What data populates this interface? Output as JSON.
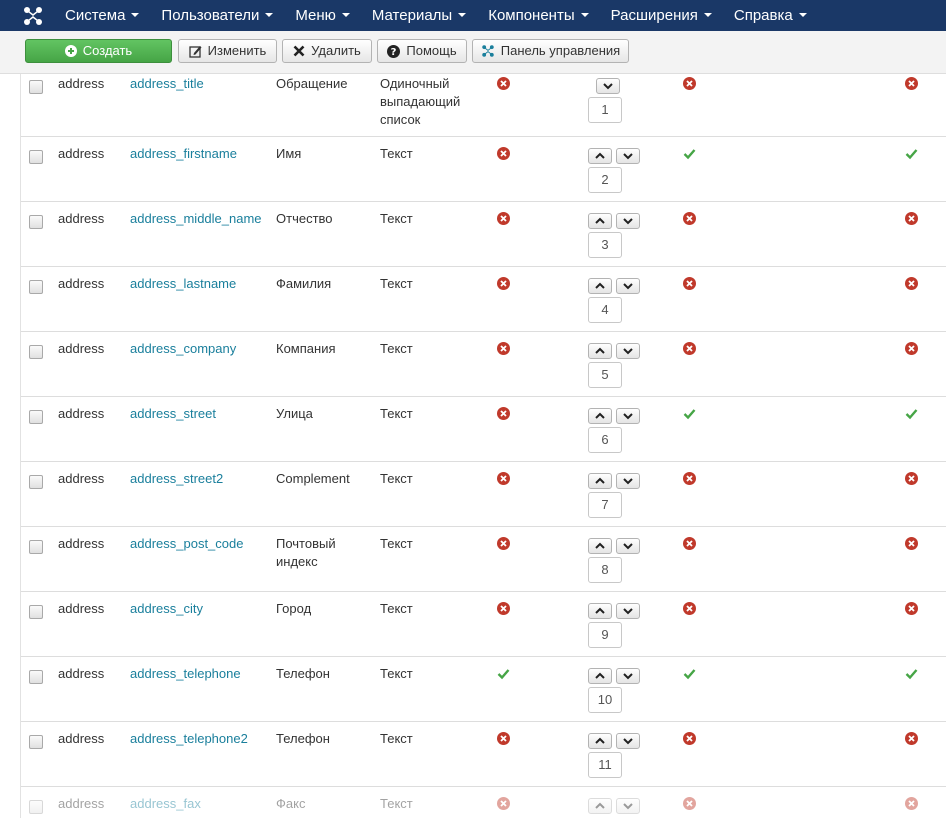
{
  "nav": {
    "menu": [
      "Система",
      "Пользователи",
      "Меню",
      "Материалы",
      "Компоненты",
      "Расширения",
      "Справка"
    ]
  },
  "toolbar": {
    "create_label": "Создать",
    "edit_label": "Изменить",
    "delete_label": "Удалить",
    "help_label": "Помощь",
    "control_panel_label": "Панель управления"
  },
  "colors": {
    "navbar": "#1a3867",
    "link": "#1a7f9c",
    "error": "#c0392b",
    "success": "#46a546"
  },
  "rows": [
    {
      "group": "address",
      "name": "address_title",
      "title": "Обращение",
      "type": "Одиночный выпадающий список",
      "s1": "no",
      "order": "1",
      "s2": "no",
      "s3": "no",
      "up": false
    },
    {
      "group": "address",
      "name": "address_firstname",
      "title": "Имя",
      "type": "Текст",
      "s1": "no",
      "order": "2",
      "s2": "yes",
      "s3": "yes",
      "up": true
    },
    {
      "group": "address",
      "name": "address_middle_name",
      "title": "Отчество",
      "type": "Текст",
      "s1": "no",
      "order": "3",
      "s2": "no",
      "s3": "no",
      "up": true
    },
    {
      "group": "address",
      "name": "address_lastname",
      "title": "Фамилия",
      "type": "Текст",
      "s1": "no",
      "order": "4",
      "s2": "no",
      "s3": "no",
      "up": true
    },
    {
      "group": "address",
      "name": "address_company",
      "title": "Компания",
      "type": "Текст",
      "s1": "no",
      "order": "5",
      "s2": "no",
      "s3": "no",
      "up": true
    },
    {
      "group": "address",
      "name": "address_street",
      "title": "Улица",
      "type": "Текст",
      "s1": "no",
      "order": "6",
      "s2": "yes",
      "s3": "yes",
      "up": true
    },
    {
      "group": "address",
      "name": "address_street2",
      "title": "Complement",
      "type": "Текст",
      "s1": "no",
      "order": "7",
      "s2": "no",
      "s3": "no",
      "up": true
    },
    {
      "group": "address",
      "name": "address_post_code",
      "title": "Почтовый индекс",
      "type": "Текст",
      "s1": "no",
      "order": "8",
      "s2": "no",
      "s3": "no",
      "up": true
    },
    {
      "group": "address",
      "name": "address_city",
      "title": "Город",
      "type": "Текст",
      "s1": "no",
      "order": "9",
      "s2": "no",
      "s3": "no",
      "up": true
    },
    {
      "group": "address",
      "name": "address_telephone",
      "title": "Телефон",
      "type": "Текст",
      "s1": "yes",
      "order": "10",
      "s2": "yes",
      "s3": "yes",
      "up": true
    },
    {
      "group": "address",
      "name": "address_telephone2",
      "title": "Телефон",
      "type": "Текст",
      "s1": "no",
      "order": "11",
      "s2": "no",
      "s3": "no",
      "up": true
    },
    {
      "group": "address",
      "name": "address_fax",
      "title": "Факс",
      "type": "Текст",
      "s1": "no",
      "order": "",
      "s2": "no",
      "s3": "no",
      "up": true
    }
  ]
}
